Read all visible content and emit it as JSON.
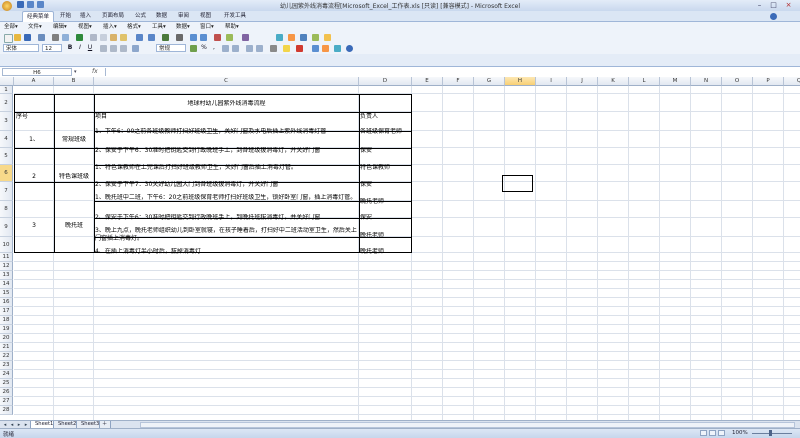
{
  "window": {
    "title": "幼儿园紫外线消毒流程[Microsoft_Excel_工作表.xls [只读] [兼容模式] - Microsoft Excel"
  },
  "ribbon": {
    "tabs": [
      "经典菜单",
      "开始",
      "插入",
      "页面布局",
      "公式",
      "数据",
      "审阅",
      "视图",
      "开发工具"
    ],
    "active_tab": "经典菜单"
  },
  "menu": {
    "items": [
      "全部▾",
      "文件▾",
      "编辑▾",
      "视图▾",
      "插入▾",
      "格式▾",
      "工具▾",
      "数据▾",
      "窗口▾",
      "帮助▾"
    ]
  },
  "format_toolbar": {
    "font_name": "宋体",
    "font_size": "12",
    "bold": "B",
    "italic": "I",
    "underline": "U",
    "number_format": "常规",
    "percent": "%",
    "comma": ","
  },
  "formula_bar": {
    "name_box": "H6",
    "fx": "fx",
    "value": ""
  },
  "sheet": {
    "columns": [
      "A",
      "B",
      "C",
      "D",
      "E",
      "F",
      "G",
      "H",
      "I",
      "J",
      "K",
      "L",
      "M",
      "N",
      "O",
      "P",
      "Q"
    ],
    "selected_column": "H",
    "rows": [
      "1",
      "2",
      "3",
      "4",
      "5",
      "6",
      "7",
      "8",
      "9",
      "10",
      "11",
      "12",
      "13",
      "14",
      "15",
      "16",
      "17",
      "18",
      "19",
      "20",
      "21",
      "22",
      "23",
      "24",
      "25",
      "26",
      "27",
      "28"
    ],
    "selected_row": "6",
    "title": "地球村幼儿园紫外线消毒流程",
    "headers": {
      "seq": "序号",
      "item": "项目",
      "owner": "负责人"
    },
    "groups": [
      {
        "seq": "1、",
        "name": "常规班级"
      },
      {
        "seq": "2",
        "name": "特色课班级"
      },
      {
        "seq": "3",
        "name": "晚托班"
      }
    ],
    "items": [
      {
        "text": "1、下午6：00之前各班级教师打扫好班级卫生，关好门窗及水电后插上紫外线消毒灯管",
        "owner": "各班级保育老师"
      },
      {
        "text": "2、保安于下午6：30准时把钥匙交到行政晚班手上，到各班级拔消毒灯，并关好门窗",
        "owner": "保安"
      },
      {
        "text": "1、特色课教师在上完课后打扫好班级教师卫生，关好门窗后插上消毒灯管。",
        "owner": "特色课教师"
      },
      {
        "text": "2、保安于下午7：30关好幼儿园大门到各班级拔消毒灯，并关好门窗",
        "owner": "保安"
      },
      {
        "text": "1、晚托班中二班，下午6：20之前班级保育老师打扫好班级卫生，锁好卧室门窗，插上消毒灯管。",
        "owner": "晚托老师"
      },
      {
        "text": "2、保安于下午6：30准时把钥匙交到行政晚班手上，到晚托班拔消毒灯，并关好门窗",
        "owner": "保安"
      },
      {
        "text": "3、晚上九点，晚托老师组织幼儿到卧室就寝，在孩子睡着后，打扫好中二班活动室卫生，然后关上门窗插上消毒灯。",
        "owner": "晚托老师"
      },
      {
        "text": "4、在插上消毒灯半小时后，拔掉消毒灯",
        "owner": "晚托老师"
      }
    ]
  },
  "sheet_tabs": {
    "tabs": [
      "Sheet1",
      "Sheet2",
      "Sheet3"
    ],
    "active": "Sheet1"
  },
  "status": {
    "text": "就绪",
    "zoom": "100%"
  },
  "colors": {
    "titlebar": "#c9d8ee",
    "selection_header": "#f8cf74",
    "grid_line": "#dbe1ea",
    "table_border": "#000000"
  }
}
